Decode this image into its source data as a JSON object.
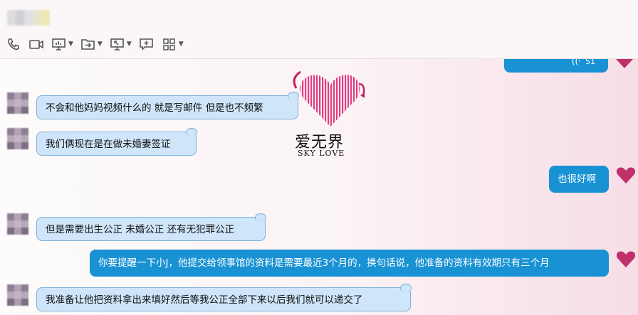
{
  "colors": {
    "incoming_bubble": "#cfe5f9",
    "outgoing_bubble": "#1992d4",
    "accent": "#e33d82"
  },
  "toolbar": {
    "items": [
      {
        "icon": "phone-icon"
      },
      {
        "icon": "video-icon"
      },
      {
        "icon": "screen-share-icon",
        "dropdown": true
      },
      {
        "icon": "file-transfer-icon",
        "dropdown": true
      },
      {
        "icon": "remote-desktop-icon",
        "dropdown": true
      },
      {
        "icon": "add-chat-icon"
      },
      {
        "icon": "apps-grid-icon",
        "dropdown": true
      }
    ]
  },
  "watermark": {
    "title": "爱无界",
    "subtitle": "SKY LOVE"
  },
  "messages": [
    {
      "direction": "out",
      "type": "voice",
      "duration": "51"
    },
    {
      "direction": "in",
      "text": "不会和他妈妈视频什么的 就是写邮件 但是也不频繁"
    },
    {
      "direction": "in",
      "text": "我们俩现在是在做未婚妻签证"
    },
    {
      "direction": "out",
      "text": "也很好啊"
    },
    {
      "direction": "in",
      "text": "但是需要出生公正 未婚公正 还有无犯罪公正"
    },
    {
      "direction": "out",
      "text": "你要提醒一下小J，他提交给领事馆的资料是需要最近3个月的，换句话说，他准备的资料有效期只有三个月"
    },
    {
      "direction": "in",
      "text": "我准备让他把资料拿出来填好然后等我公正全部下来以后我们就可以递交了"
    }
  ]
}
